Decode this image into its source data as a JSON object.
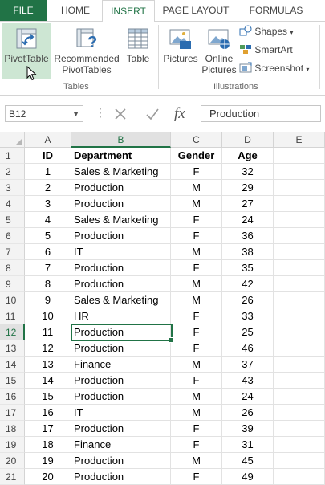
{
  "tabs": [
    {
      "label": "FILE"
    },
    {
      "label": "HOME"
    },
    {
      "label": "INSERT"
    },
    {
      "label": "PAGE LAYOUT"
    },
    {
      "label": "FORMULAS"
    }
  ],
  "ribbon": {
    "tables": {
      "pivot_line1": "PivotTable",
      "recommended_line1": "Recommended",
      "recommended_line2": "PivotTables",
      "table_label": "Table",
      "group_label": "Tables"
    },
    "illustrations": {
      "pictures_label": "Pictures",
      "online_line1": "Online",
      "online_line2": "Pictures",
      "shapes_label": "Shapes",
      "smartart_label": "SmartArt",
      "screenshot_label": "Screenshot",
      "group_label": "Illustrations"
    }
  },
  "formula_bar": {
    "name_box": "B12",
    "fx": "fx",
    "content": "Production"
  },
  "columns": [
    "A",
    "B",
    "C",
    "D",
    "E"
  ],
  "selected": {
    "column": "B",
    "row": "12"
  },
  "rows": [
    {
      "n": "1",
      "id": "ID",
      "dept": "Department",
      "gender": "Gender",
      "age": "Age"
    },
    {
      "n": "2",
      "id": "1",
      "dept": "Sales & Marketing",
      "gender": "F",
      "age": "32"
    },
    {
      "n": "3",
      "id": "2",
      "dept": "Production",
      "gender": "M",
      "age": "29"
    },
    {
      "n": "4",
      "id": "3",
      "dept": "Production",
      "gender": "M",
      "age": "27"
    },
    {
      "n": "5",
      "id": "4",
      "dept": "Sales & Marketing",
      "gender": "F",
      "age": "24"
    },
    {
      "n": "6",
      "id": "5",
      "dept": "Production",
      "gender": "F",
      "age": "36"
    },
    {
      "n": "7",
      "id": "6",
      "dept": "IT",
      "gender": "M",
      "age": "38"
    },
    {
      "n": "8",
      "id": "7",
      "dept": "Production",
      "gender": "F",
      "age": "35"
    },
    {
      "n": "9",
      "id": "8",
      "dept": "Production",
      "gender": "M",
      "age": "42"
    },
    {
      "n": "10",
      "id": "9",
      "dept": "Sales & Marketing",
      "gender": "M",
      "age": "26"
    },
    {
      "n": "11",
      "id": "10",
      "dept": "HR",
      "gender": "F",
      "age": "33"
    },
    {
      "n": "12",
      "id": "11",
      "dept": "Production",
      "gender": "F",
      "age": "25"
    },
    {
      "n": "13",
      "id": "12",
      "dept": "Production",
      "gender": "F",
      "age": "46"
    },
    {
      "n": "14",
      "id": "13",
      "dept": "Finance",
      "gender": "M",
      "age": "37"
    },
    {
      "n": "15",
      "id": "14",
      "dept": "Production",
      "gender": "F",
      "age": "43"
    },
    {
      "n": "16",
      "id": "15",
      "dept": "Production",
      "gender": "M",
      "age": "24"
    },
    {
      "n": "17",
      "id": "16",
      "dept": "IT",
      "gender": "M",
      "age": "26"
    },
    {
      "n": "18",
      "id": "17",
      "dept": "Production",
      "gender": "F",
      "age": "39"
    },
    {
      "n": "19",
      "id": "18",
      "dept": "Finance",
      "gender": "F",
      "age": "31"
    },
    {
      "n": "20",
      "id": "19",
      "dept": "Production",
      "gender": "M",
      "age": "45"
    },
    {
      "n": "21",
      "id": "20",
      "dept": "Production",
      "gender": "F",
      "age": "49"
    }
  ],
  "colors": {
    "accent": "#217346",
    "header_bg": "#f3f3f3",
    "pivot_highlight": "#cde6d3"
  }
}
